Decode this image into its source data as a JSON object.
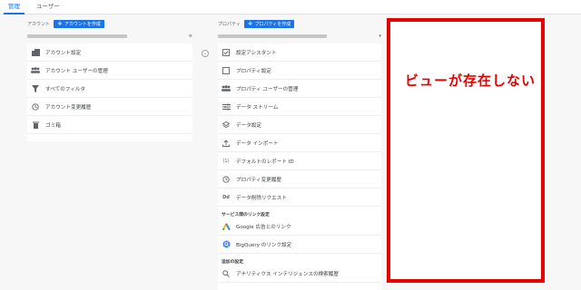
{
  "tabs": [
    {
      "label": "管理",
      "active": true
    },
    {
      "label": "ユーザー",
      "active": false
    }
  ],
  "account": {
    "header_label": "アカウント",
    "create_button": "アカウントを作成",
    "items": [
      {
        "icon": "building-icon",
        "label": "アカウント設定"
      },
      {
        "icon": "people-icon",
        "label": "アカウント ユーザーの管理"
      },
      {
        "icon": "filter-icon",
        "label": "すべてのフィルタ"
      },
      {
        "icon": "history-icon",
        "label": "アカウント変更履歴"
      },
      {
        "icon": "trash-icon",
        "label": "ゴミ箱"
      }
    ]
  },
  "property": {
    "header_label": "プロパティ",
    "create_button": "プロパティを作成",
    "items": [
      {
        "icon": "checkbox-icon",
        "label": "設定アシスタント"
      },
      {
        "icon": "square-icon",
        "label": "プロパティ設定"
      },
      {
        "icon": "people-icon",
        "label": "プロパティ ユーザーの管理"
      },
      {
        "icon": "stream-icon",
        "label": "データ ストリーム"
      },
      {
        "icon": "layers-icon",
        "label": "データ設定"
      },
      {
        "icon": "upload-icon",
        "label": "データ インポート"
      },
      {
        "icon": "report-id-icon",
        "label": "デフォルトのレポート ID"
      },
      {
        "icon": "history-icon",
        "label": "プロパティ変更履歴"
      },
      {
        "icon": "dd-icon",
        "label": "データ削除リクエスト"
      }
    ],
    "service_section": "サービス間のリンク設定",
    "service_items": [
      {
        "icon": "google-ads-icon",
        "label": "Google 広告とのリンク"
      },
      {
        "icon": "bigquery-icon",
        "label": "BigQuery のリンク設定"
      }
    ],
    "additional_section": "追加の設定",
    "additional_items": [
      {
        "icon": "search-history-icon",
        "label": "アナリティクス インテリジェンスの検索履歴"
      }
    ]
  },
  "annotation": {
    "text": "ビューが存在しない",
    "color": "#e60000"
  },
  "colors": {
    "accent": "#1a73e8"
  }
}
